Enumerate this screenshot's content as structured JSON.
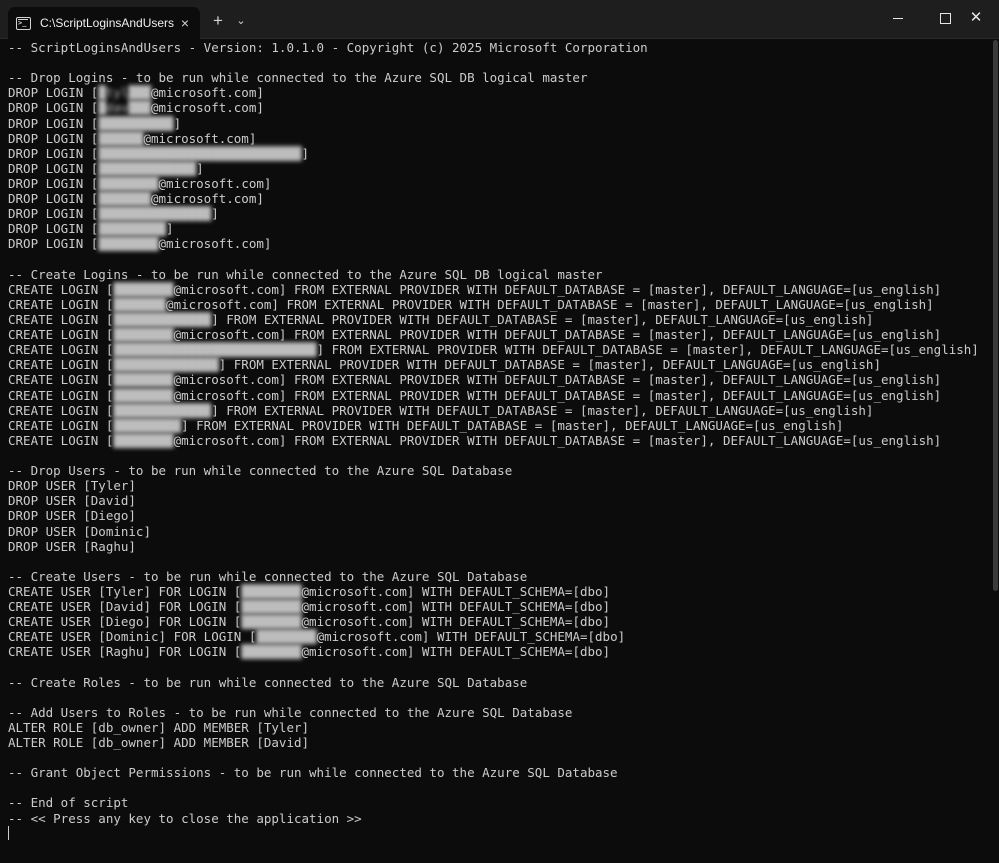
{
  "window": {
    "tab_title": "C:\\ScriptLoginsAndUsers\\Scrip",
    "tab_close": "×",
    "new_tab": "+",
    "tab_dropdown": "⌄",
    "close_glyph": "✕"
  },
  "icons": [
    "terminal-icon",
    "close-icon",
    "plus-icon",
    "chevron-down-icon",
    "minimize-icon",
    "maximize-icon",
    "close-window-icon"
  ],
  "console": {
    "lines": [
      {
        "pre": "-- ScriptLoginsAndUsers - Version: 1.0.1.0 - Copyright (c) 2025 Microsoft Corporation"
      },
      {
        "pre": ""
      },
      {
        "pre": "-- Drop Logins - to be run while connected to the Azure SQL DB logical master"
      },
      {
        "pre": "DROP LOGIN [",
        "red": "█tyl███",
        "post": "@microsoft.com]"
      },
      {
        "pre": "DROP LOGIN [",
        "red": "█dav███",
        "post": "@microsoft.com]"
      },
      {
        "pre": "DROP LOGIN [",
        "red": "██████████",
        "post": "]"
      },
      {
        "pre": "DROP LOGIN [",
        "red": "██████",
        "post": "@microsoft.com]"
      },
      {
        "pre": "DROP LOGIN [",
        "red": "███████████████████████████",
        "post": "]"
      },
      {
        "pre": "DROP LOGIN [",
        "red": "█████████████",
        "post": "]"
      },
      {
        "pre": "DROP LOGIN [",
        "red": "████████",
        "post": "@microsoft.com]"
      },
      {
        "pre": "DROP LOGIN [",
        "red": "███████",
        "post": "@microsoft.com]"
      },
      {
        "pre": "DROP LOGIN [",
        "red": "███████████████",
        "post": "]"
      },
      {
        "pre": "DROP LOGIN [",
        "red": "█████████",
        "post": "]"
      },
      {
        "pre": "DROP LOGIN [",
        "red": "████████",
        "post": "@microsoft.com]"
      },
      {
        "pre": ""
      },
      {
        "pre": "-- Create Logins - to be run while connected to the Azure SQL DB logical master"
      },
      {
        "pre": "CREATE LOGIN [",
        "red": "████████",
        "post": "@microsoft.com] FROM EXTERNAL PROVIDER WITH DEFAULT_DATABASE = [master], DEFAULT_LANGUAGE=[us_english]"
      },
      {
        "pre": "CREATE LOGIN [",
        "red": "███████",
        "post": "@microsoft.com] FROM EXTERNAL PROVIDER WITH DEFAULT_DATABASE = [master], DEFAULT_LANGUAGE=[us_english]"
      },
      {
        "pre": "CREATE LOGIN [",
        "red": "█████████████",
        "post": "] FROM EXTERNAL PROVIDER WITH DEFAULT_DATABASE = [master], DEFAULT_LANGUAGE=[us_english]"
      },
      {
        "pre": "CREATE LOGIN [",
        "red": "████████",
        "post": "@microsoft.com] FROM EXTERNAL PROVIDER WITH DEFAULT_DATABASE = [master], DEFAULT_LANGUAGE=[us_english]"
      },
      {
        "pre": "CREATE LOGIN [",
        "red": "███████████████████████████",
        "post": "] FROM EXTERNAL PROVIDER WITH DEFAULT_DATABASE = [master], DEFAULT_LANGUAGE=[us_english]"
      },
      {
        "pre": "CREATE LOGIN [",
        "red": "██████████████",
        "post": "] FROM EXTERNAL PROVIDER WITH DEFAULT_DATABASE = [master], DEFAULT_LANGUAGE=[us_english]"
      },
      {
        "pre": "CREATE LOGIN [",
        "red": "████████",
        "post": "@microsoft.com] FROM EXTERNAL PROVIDER WITH DEFAULT_DATABASE = [master], DEFAULT_LANGUAGE=[us_english]"
      },
      {
        "pre": "CREATE LOGIN [",
        "red": "████████",
        "post": "@microsoft.com] FROM EXTERNAL PROVIDER WITH DEFAULT_DATABASE = [master], DEFAULT_LANGUAGE=[us_english]"
      },
      {
        "pre": "CREATE LOGIN [",
        "red": "█████████████",
        "post": "] FROM EXTERNAL PROVIDER WITH DEFAULT_DATABASE = [master], DEFAULT_LANGUAGE=[us_english]"
      },
      {
        "pre": "CREATE LOGIN [",
        "red": "█████████",
        "post": "] FROM EXTERNAL PROVIDER WITH DEFAULT_DATABASE = [master], DEFAULT_LANGUAGE=[us_english]"
      },
      {
        "pre": "CREATE LOGIN [",
        "red": "████████",
        "post": "@microsoft.com] FROM EXTERNAL PROVIDER WITH DEFAULT_DATABASE = [master], DEFAULT_LANGUAGE=[us_english]"
      },
      {
        "pre": ""
      },
      {
        "pre": "-- Drop Users - to be run while connected to the Azure SQL Database"
      },
      {
        "pre": "DROP USER [Tyler]"
      },
      {
        "pre": "DROP USER [David]"
      },
      {
        "pre": "DROP USER [Diego]"
      },
      {
        "pre": "DROP USER [Dominic]"
      },
      {
        "pre": "DROP USER [Raghu]"
      },
      {
        "pre": ""
      },
      {
        "pre": "-- Create Users - to be run while connected to the Azure SQL Database"
      },
      {
        "pre": "CREATE USER [Tyler] FOR LOGIN [",
        "red": "████████",
        "post": "@microsoft.com] WITH DEFAULT_SCHEMA=[dbo]"
      },
      {
        "pre": "CREATE USER [David] FOR LOGIN [",
        "red": "████████",
        "post": "@microsoft.com] WITH DEFAULT_SCHEMA=[dbo]"
      },
      {
        "pre": "CREATE USER [Diego] FOR LOGIN [",
        "red": "████████",
        "post": "@microsoft.com] WITH DEFAULT_SCHEMA=[dbo]"
      },
      {
        "pre": "CREATE USER [Dominic] FOR LOGIN [",
        "red": "████████",
        "post": "@microsoft.com] WITH DEFAULT_SCHEMA=[dbo]"
      },
      {
        "pre": "CREATE USER [Raghu] FOR LOGIN [",
        "red": "████████",
        "post": "@microsoft.com] WITH DEFAULT_SCHEMA=[dbo]"
      },
      {
        "pre": ""
      },
      {
        "pre": "-- Create Roles - to be run while connected to the Azure SQL Database"
      },
      {
        "pre": ""
      },
      {
        "pre": "-- Add Users to Roles - to be run while connected to the Azure SQL Database"
      },
      {
        "pre": "ALTER ROLE [db_owner] ADD MEMBER [Tyler]"
      },
      {
        "pre": "ALTER ROLE [db_owner] ADD MEMBER [David]"
      },
      {
        "pre": ""
      },
      {
        "pre": "-- Grant Object Permissions - to be run while connected to the Azure SQL Database"
      },
      {
        "pre": ""
      },
      {
        "pre": "-- End of script"
      },
      {
        "pre": "-- << Press any key to close the application >>"
      }
    ]
  }
}
